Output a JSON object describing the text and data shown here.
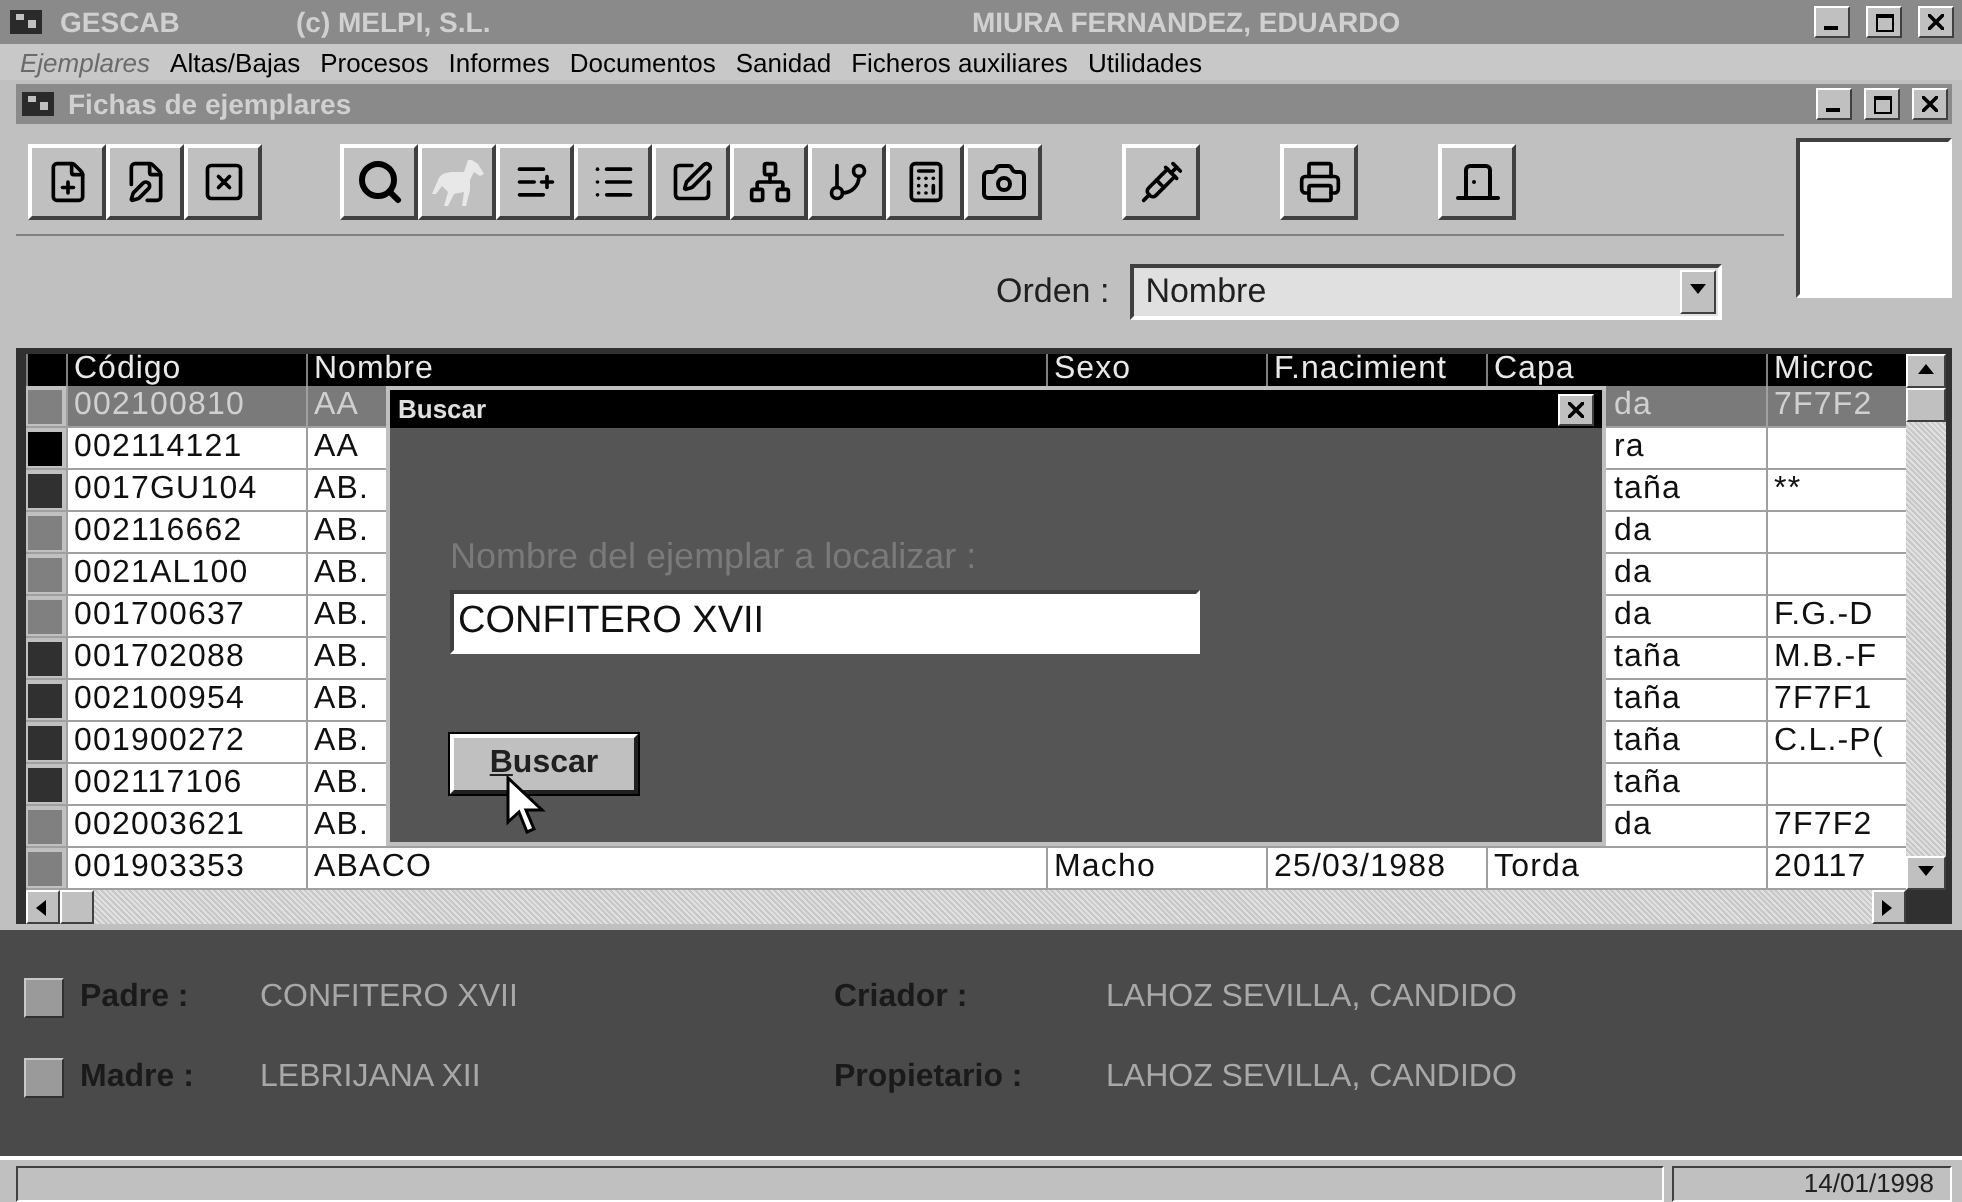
{
  "app_title": {
    "name": "GESCAB",
    "copyright": "(c) MELPI, S.L.",
    "user": "MIURA FERNANDEZ, EDUARDO"
  },
  "menu": [
    {
      "label": "Ejemplares",
      "disabled": true
    },
    {
      "label": "Altas/Bajas",
      "disabled": false
    },
    {
      "label": "Procesos",
      "disabled": false
    },
    {
      "label": "Informes",
      "disabled": false
    },
    {
      "label": "Documentos",
      "disabled": false
    },
    {
      "label": "Sanidad",
      "disabled": false
    },
    {
      "label": "Ficheros auxiliares",
      "disabled": false
    },
    {
      "label": "Utilidades",
      "disabled": false
    }
  ],
  "child_window": {
    "title": "Fichas de ejemplares"
  },
  "order": {
    "label": "Orden :",
    "value": "Nombre"
  },
  "table": {
    "columns": [
      "Código",
      "Nombre",
      "Sexo",
      "F.nacimient",
      "Capa",
      "Microc"
    ],
    "rows": [
      {
        "code": "002100810",
        "name": "AA",
        "capa": "da",
        "chip": "7F7F2",
        "color": "#808080",
        "selected": true
      },
      {
        "code": "002114121",
        "name": "AA",
        "capa": "ra",
        "chip": "",
        "color": "#000000",
        "selected": false
      },
      {
        "code": "0017GU104",
        "name": "AB.",
        "capa": "taña",
        "chip": "**",
        "color": "#303030",
        "selected": false
      },
      {
        "code": "002116662",
        "name": "AB.",
        "capa": "da",
        "chip": "",
        "color": "#808080",
        "selected": false
      },
      {
        "code": "0021AL100",
        "name": "AB.",
        "capa": "da",
        "chip": "",
        "color": "#808080",
        "selected": false
      },
      {
        "code": "001700637",
        "name": "AB.",
        "capa": "da",
        "chip": "F.G.-D",
        "color": "#808080",
        "selected": false
      },
      {
        "code": "001702088",
        "name": "AB.",
        "capa": "taña",
        "chip": "M.B.-F",
        "color": "#303030",
        "selected": false
      },
      {
        "code": "002100954",
        "name": "AB.",
        "capa": "taña",
        "chip": "7F7F1",
        "color": "#303030",
        "selected": false
      },
      {
        "code": "001900272",
        "name": "AB.",
        "capa": "taña",
        "chip": "C.L.-P(",
        "color": "#303030",
        "selected": false
      },
      {
        "code": "002117106",
        "name": "AB.",
        "capa": "taña",
        "chip": "",
        "color": "#303030",
        "selected": false
      },
      {
        "code": "002003621",
        "name": "AB.",
        "capa": "da",
        "chip": "7F7F2",
        "color": "#808080",
        "selected": false
      },
      {
        "code": "001903353",
        "name": "ABACO",
        "sexo": "Macho",
        "birth": "25/03/1988",
        "capa": "Torda",
        "chip": "20117",
        "color": "#808080",
        "selected": false
      }
    ]
  },
  "dialog": {
    "title": "Buscar",
    "prompt": "Nombre del ejemplar a localizar :",
    "value": "CONFITERO XVII",
    "button": "Buscar"
  },
  "details": [
    {
      "kind": "parent",
      "label": "Padre :",
      "value": "CONFITERO XVII"
    },
    {
      "kind": "person",
      "label": "Criador :",
      "value": "LAHOZ SEVILLA, CANDIDO"
    },
    {
      "kind": "parent",
      "label": "Madre :",
      "value": "LEBRIJANA XII"
    },
    {
      "kind": "person",
      "label": "Propietario :",
      "value": "LAHOZ SEVILLA, CANDIDO"
    }
  ],
  "status_bar": {
    "date": "14/01/1998"
  }
}
